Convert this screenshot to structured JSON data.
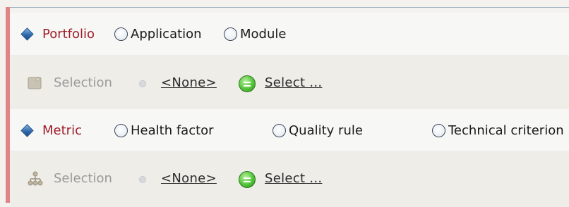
{
  "portfolio": {
    "title": "Portfolio",
    "options": [
      {
        "label": "Application"
      },
      {
        "label": "Module"
      }
    ],
    "selection": {
      "label": "Selection",
      "current": "<None>",
      "select_link": "Select ..."
    }
  },
  "metric": {
    "title": "Metric",
    "options": [
      {
        "label": "Health factor"
      },
      {
        "label": "Quality rule"
      },
      {
        "label": "Technical criterion"
      }
    ],
    "selection": {
      "label": "Selection",
      "current": "<None>",
      "select_link": "Select ..."
    }
  },
  "colors": {
    "accent": "#e08487",
    "section_title": "#a01d2a",
    "green_button": "#54c43a"
  },
  "icons": {
    "section": "blue-diamond-icon",
    "portfolio_selection": "folder-icon",
    "metric_selection": "hierarchy-icon",
    "select_action": "green-select-icon"
  }
}
